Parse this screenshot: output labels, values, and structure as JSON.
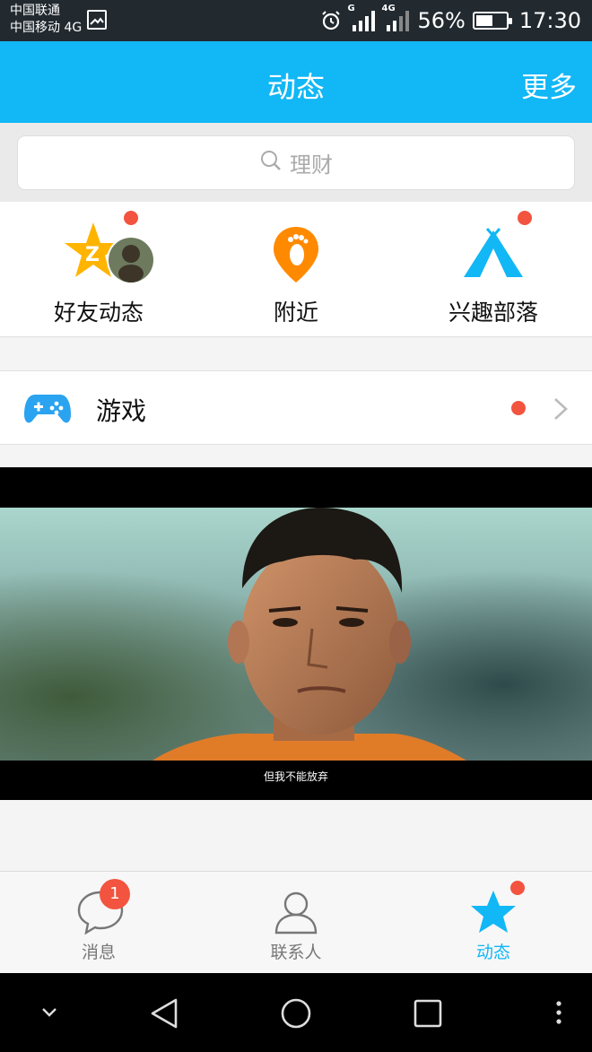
{
  "status_bar": {
    "carrier_1": "中国联通",
    "carrier_2": "中国移动 4G",
    "net_1": "G",
    "net_2": "4G",
    "battery": "56%",
    "battery_level": 0.56,
    "time": "17:30"
  },
  "header": {
    "title": "动态",
    "more": "更多"
  },
  "search": {
    "placeholder": "理财"
  },
  "shortcuts": [
    {
      "label": "好友动态",
      "icon": "qzone-star-icon",
      "has_dot": true
    },
    {
      "label": "附近",
      "icon": "footprint-pin-icon",
      "has_dot": false
    },
    {
      "label": "兴趣部落",
      "icon": "tent-icon",
      "has_dot": true
    }
  ],
  "games": {
    "label": "游戏",
    "icon": "gamepad-icon",
    "has_dot": true
  },
  "video": {
    "subtitle": "但我不能放弃"
  },
  "tabs": [
    {
      "label": "消息",
      "icon": "chat-bubble-icon",
      "badge": "1",
      "active": false
    },
    {
      "label": "联系人",
      "icon": "contacts-icon",
      "badge": "",
      "active": false
    },
    {
      "label": "动态",
      "icon": "star-icon",
      "badge": "",
      "active": true
    }
  ],
  "colors": {
    "accent": "#12b7f5",
    "notification": "#f2543f",
    "orange": "#ff8a00",
    "game_blue": "#2aa3f0"
  },
  "nav_buttons": [
    "collapse-icon",
    "back-icon",
    "home-icon",
    "recents-icon",
    "menu-icon"
  ]
}
